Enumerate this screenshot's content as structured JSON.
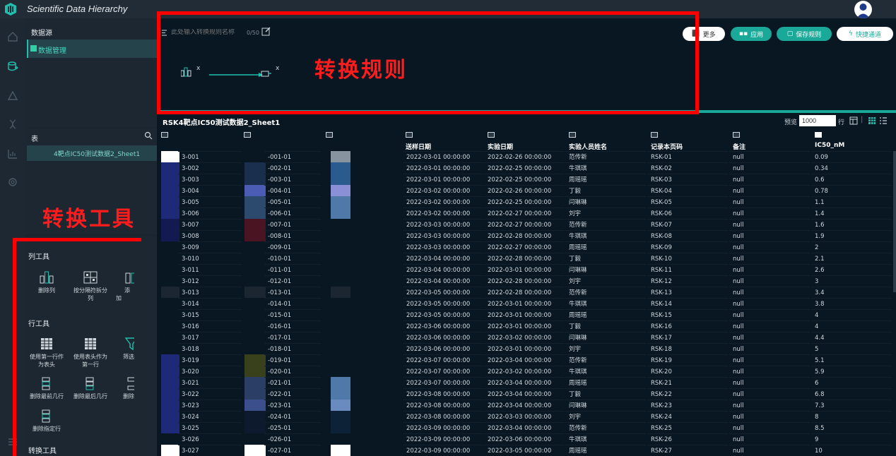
{
  "app": {
    "title": "Scientific Data Hierarchy"
  },
  "datasource": {
    "heading": "数据源",
    "item": "数据管理"
  },
  "tables": {
    "heading": "表",
    "item": "4靶点IC50测试数据2_Sheet1"
  },
  "annotations": {
    "rule_label": "转换规则",
    "tool_label": "转换工具"
  },
  "rule": {
    "name_placeholder": "此处输入转换规则名称",
    "char_count": "0/50",
    "x1": "x",
    "x2": "x",
    "buttons": {
      "more": "更多",
      "apply": "应用",
      "save": "保存规则",
      "quick": "快捷通道"
    }
  },
  "toolbox": {
    "column_tools": {
      "title": "列工具",
      "items": [
        "删除列",
        "按分隔符拆分列",
        "添加"
      ]
    },
    "row_tools": {
      "title": "行工具",
      "items": [
        "使用第一行作为表头",
        "使用表头作为第一行",
        "筛选",
        "删除最前几行",
        "删除最后几行",
        "删除",
        "删除指定行"
      ]
    },
    "transform_tools": {
      "title": "转换工具"
    }
  },
  "table": {
    "title": "RSK4靶点IC50测试数据2_Sheet1",
    "preview_label": "预览",
    "preview_value": "1000",
    "rows_label": "行",
    "columns": [
      "送样日期",
      "实验日期",
      "实验人员姓名",
      "记录本页码",
      "备注",
      "IC50_nM"
    ],
    "rows": [
      [
        "3-001",
        "-001-01",
        "2022-03-01 00:00:00",
        "2022-02-26 00:00:00",
        "范传新",
        "RSK-01",
        "null",
        "0.09"
      ],
      [
        "3-002",
        "-002-01",
        "2022-03-01 00:00:00",
        "2022-02-25 00:00:00",
        "牛琪琪",
        "RSK-02",
        "null",
        "0.34"
      ],
      [
        "3-003",
        "-003-01",
        "2022-03-01 00:00:00",
        "2022-02-25 00:00:00",
        "周瑶瑶",
        "RSK-03",
        "null",
        "0.6"
      ],
      [
        "3-004",
        "-004-01",
        "2022-03-02 00:00:00",
        "2022-02-26 00:00:00",
        "丁毅",
        "RSK-04",
        "null",
        "0.78"
      ],
      [
        "3-005",
        "-005-01",
        "2022-03-02 00:00:00",
        "2022-02-25 00:00:00",
        "闫琳琳",
        "RSK-05",
        "null",
        "1.1"
      ],
      [
        "3-006",
        "-006-01",
        "2022-03-02 00:00:00",
        "2022-02-27 00:00:00",
        "刘宇",
        "RSK-06",
        "null",
        "1.4"
      ],
      [
        "3-007",
        "-007-01",
        "2022-03-03 00:00:00",
        "2022-02-27 00:00:00",
        "范传新",
        "RSK-07",
        "null",
        "1.6"
      ],
      [
        "3-008",
        "-008-01",
        "2022-03-03 00:00:00",
        "2022-02-28 00:00:00",
        "牛琪琪",
        "RSK-08",
        "null",
        "1.9"
      ],
      [
        "3-009",
        "-009-01",
        "2022-03-03 00:00:00",
        "2022-02-27 00:00:00",
        "周瑶瑶",
        "RSK-09",
        "null",
        "2"
      ],
      [
        "3-010",
        "-010-01",
        "2022-03-04 00:00:00",
        "2022-02-28 00:00:00",
        "丁毅",
        "RSK-10",
        "null",
        "2.1"
      ],
      [
        "3-011",
        "-011-01",
        "2022-03-04 00:00:00",
        "2022-03-01 00:00:00",
        "闫琳琳",
        "RSK-11",
        "null",
        "2.6"
      ],
      [
        "3-012",
        "-012-01",
        "2022-03-04 00:00:00",
        "2022-02-28 00:00:00",
        "刘宇",
        "RSK-12",
        "null",
        "3"
      ],
      [
        "3-013",
        "-013-01",
        "2022-03-05 00:00:00",
        "2022-02-28 00:00:00",
        "范传新",
        "RSK-13",
        "null",
        "3.4"
      ],
      [
        "3-014",
        "-014-01",
        "2022-03-05 00:00:00",
        "2022-03-01 00:00:00",
        "牛琪琪",
        "RSK-14",
        "null",
        "3.8"
      ],
      [
        "3-015",
        "-015-01",
        "2022-03-05 00:00:00",
        "2022-03-01 00:00:00",
        "周瑶瑶",
        "RSK-15",
        "null",
        "4"
      ],
      [
        "3-016",
        "-016-01",
        "2022-03-06 00:00:00",
        "2022-03-01 00:00:00",
        "丁毅",
        "RSK-16",
        "null",
        "4"
      ],
      [
        "3-017",
        "-017-01",
        "2022-03-06 00:00:00",
        "2022-03-02 00:00:00",
        "闫琳琳",
        "RSK-17",
        "null",
        "4.4"
      ],
      [
        "3-018",
        "-018-01",
        "2022-03-06 00:00:00",
        "2022-03-01 00:00:00",
        "刘宇",
        "RSK-18",
        "null",
        "5"
      ],
      [
        "3-019",
        "-019-01",
        "2022-03-07 00:00:00",
        "2022-03-04 00:00:00",
        "范传新",
        "RSK-19",
        "null",
        "5.1"
      ],
      [
        "3-020",
        "-020-01",
        "2022-03-07 00:00:00",
        "2022-03-02 00:00:00",
        "牛琪琪",
        "RSK-20",
        "null",
        "5.9"
      ],
      [
        "3-021",
        "-021-01",
        "2022-03-07 00:00:00",
        "2022-03-04 00:00:00",
        "周瑶瑶",
        "RSK-21",
        "null",
        "6"
      ],
      [
        "3-022",
        "-022-01",
        "2022-03-08 00:00:00",
        "2022-03-04 00:00:00",
        "丁毅",
        "RSK-22",
        "null",
        "6.8"
      ],
      [
        "3-023",
        "-023-01",
        "2022-03-08 00:00:00",
        "2022-03-04 00:00:00",
        "闫琳琳",
        "RSK-23",
        "null",
        "7.3"
      ],
      [
        "3-024",
        "-024-01",
        "2022-03-08 00:00:00",
        "2022-03-03 00:00:00",
        "刘宇",
        "RSK-24",
        "null",
        "8"
      ],
      [
        "3-025",
        "-025-01",
        "2022-03-09 00:00:00",
        "2022-03-04 00:00:00",
        "范传新",
        "RSK-25",
        "null",
        "8.5"
      ],
      [
        "3-026",
        "-026-01",
        "2022-03-09 00:00:00",
        "2022-03-06 00:00:00",
        "牛琪琪",
        "RSK-26",
        "null",
        "9"
      ],
      [
        "3-027",
        "-027-01",
        "2022-03-09 00:00:00",
        "2022-03-05 00:00:00",
        "周瑶瑶",
        "RSK-27",
        "null",
        "10"
      ]
    ],
    "block_colors": {
      "col1": [
        "#ffffff",
        "#1e2a78",
        "#1e2a78",
        "#1e2a78",
        "#1e2a78",
        "#1e2a78",
        "#131a52",
        "#131a52",
        "#091722",
        "#091722",
        "#091722",
        "#091722",
        "#1c2630",
        "#091722",
        "#091722",
        "#091722",
        "#091722",
        "#091722",
        "#1e2a78",
        "#1e2a78",
        "#1e2a78",
        "#1e2a78",
        "#1e2a78",
        "#1e2a78",
        "#1e2a78",
        "#091722",
        "#ffffff"
      ],
      "col2": [
        "#091722",
        "#1a2f4e",
        "#1a2f4e",
        "#4a5cb3",
        "#2b4a6d",
        "#2b4a6d",
        "#4a1422",
        "#4a1422",
        "#091722",
        "#091722",
        "#091722",
        "#091722",
        "#1c2630",
        "#091722",
        "#091722",
        "#091722",
        "#091722",
        "#091722",
        "#39401c",
        "#39401c",
        "#2b3f66",
        "#2b3f66",
        "#3a4f8c",
        "#0d1a2e",
        "#0d1a2e",
        "#091722",
        "#ffffff"
      ],
      "col3": [
        "#8893a0",
        "#2b5a8f",
        "#2b5a8f",
        "#8a8fd6",
        "#4f79a8",
        "#4f79a8",
        "#091722",
        "#091722",
        "#091722",
        "#091722",
        "#091722",
        "#091722",
        "#1c2630",
        "#091722",
        "#091722",
        "#091722",
        "#091722",
        "#091722",
        "#091722",
        "#091722",
        "#4f79a8",
        "#4f79a8",
        "#6a8bc0",
        "#0d2236",
        "#0d2236",
        "#091722",
        "#ffffff"
      ]
    }
  }
}
